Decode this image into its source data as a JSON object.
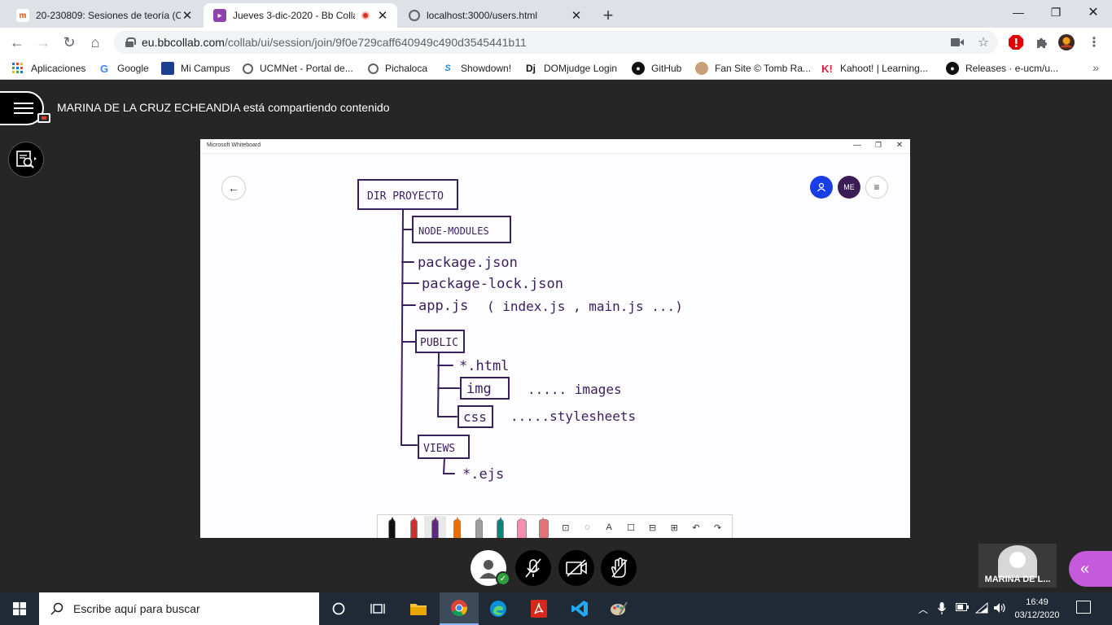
{
  "browser": {
    "tabs": [
      {
        "title": "20-230809: Sesiones de teoría (C",
        "active": false
      },
      {
        "title": "Jueves 3-dic-2020 - Bb Colla",
        "active": true,
        "recording": true
      },
      {
        "title": "localhost:3000/users.html",
        "active": false
      }
    ],
    "close_glyph": "✕",
    "new_tab_glyph": "+",
    "window_controls": {
      "minimize": "—",
      "maximize": "❐",
      "close": "✕"
    },
    "url_host": "eu.bbcollab.com",
    "url_path": "/collab/ui/session/join/9f0e729caff640949c490d3545441b11",
    "bookmarks": [
      {
        "label": "Aplicaciones",
        "icon": "apps-grid-icon"
      },
      {
        "label": "Google",
        "icon": "google-icon"
      },
      {
        "label": "Mi Campus",
        "icon": "campus-icon"
      },
      {
        "label": "UCMNet - Portal de...",
        "icon": "globe-icon"
      },
      {
        "label": "Pichaloca",
        "icon": "globe-icon"
      },
      {
        "label": "Showdown!",
        "icon": "showdown-icon"
      },
      {
        "label": "DOMjudge Login",
        "icon": "domjudge-icon"
      },
      {
        "label": "GitHub",
        "icon": "github-icon"
      },
      {
        "label": "Fan Site © Tomb Ra...",
        "icon": "fansite-icon"
      },
      {
        "label": "Kahoot! | Learning...",
        "icon": "kahoot-icon"
      },
      {
        "label": "Releases · e-ucm/u...",
        "icon": "github-icon"
      }
    ],
    "bookmarks_more": "»"
  },
  "collab": {
    "sharing_text": "MARINA DE LA CRUZ ECHEANDIA está compartiendo contenido",
    "participant_name": "MARINA DE L...",
    "panel_glyph": "«"
  },
  "whiteboard": {
    "window_title": "Microsoft Whiteboard",
    "window_controls": {
      "minimize": "—",
      "maximize": "❐",
      "close": "✕"
    },
    "back_glyph": "←",
    "avatar_me": "ME",
    "menu_glyph": "≡",
    "drawing": {
      "root": "DIR PROYECTO",
      "node_modules": "NODE-MODULES",
      "package_json": "package.json",
      "package_lock": "package-lock.json",
      "app_js": "app.js",
      "app_alt": "( index.js , main.js ...)",
      "public": "PUBLIC",
      "html": "*.html",
      "img": "img",
      "img_note": "..... images",
      "css": "css",
      "css_note": ".....stylesheets",
      "views": "VIEWS",
      "ejs": "*.ejs"
    },
    "tools": [
      {
        "name": "black-pen",
        "color": "#111111"
      },
      {
        "name": "red-pen",
        "color": "#d32f2f"
      },
      {
        "name": "purple-pen",
        "color": "#5b2a86"
      },
      {
        "name": "orange-pen",
        "color": "#ef6c00"
      },
      {
        "name": "gray-pen",
        "color": "#9e9e9e"
      },
      {
        "name": "teal-pen",
        "color": "#00897b"
      },
      {
        "name": "highlighter-pink",
        "color": "#f48fb1"
      },
      {
        "name": "eraser",
        "color": "#e57373"
      }
    ],
    "tool_glyphs": {
      "ruler": "⊡",
      "lasso": "◌",
      "text": "A",
      "note": "☐",
      "image": "⊟",
      "add": "⊞",
      "undo": "↶",
      "redo": "↷"
    }
  },
  "taskbar": {
    "search_placeholder": "Escribe aquí para buscar",
    "time": "16:49",
    "date": "03/12/2020"
  }
}
